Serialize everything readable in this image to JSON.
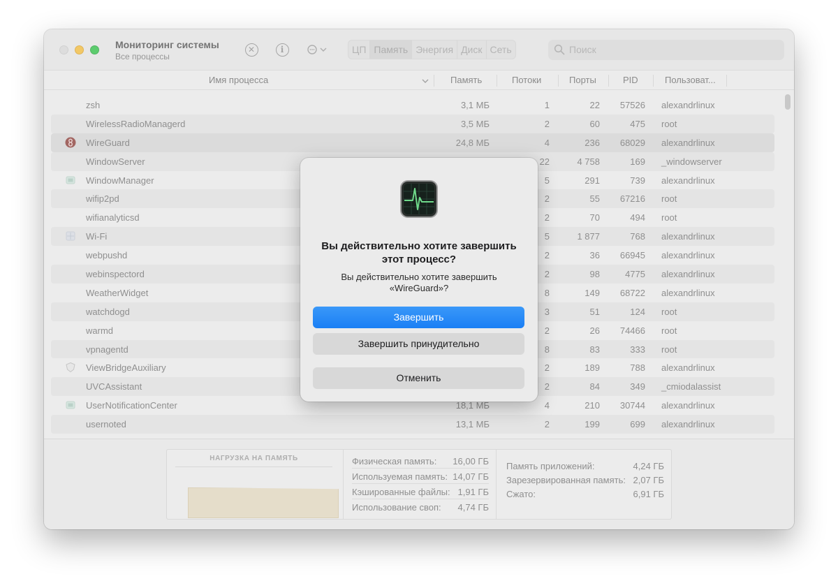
{
  "app": {
    "title": "Мониторинг системы",
    "subtitle": "Все процессы"
  },
  "toolbar": {
    "tabs": [
      "ЦП",
      "Память",
      "Энергия",
      "Диск",
      "Сеть"
    ],
    "active_tab": "Память",
    "search_placeholder": "Поиск"
  },
  "table": {
    "columns": {
      "name": "Имя процесса",
      "memory": "Память",
      "threads": "Потоки",
      "ports": "Порты",
      "pid": "PID",
      "user": "Пользоват..."
    },
    "rows": [
      {
        "name": "zsh",
        "memory": "3,1 МБ",
        "threads": "1",
        "ports": "22",
        "pid": "57526",
        "user": "alexandrlinux",
        "icon": "none"
      },
      {
        "name": "WirelessRadioManagerd",
        "memory": "3,5 МБ",
        "threads": "2",
        "ports": "60",
        "pid": "475",
        "user": "root",
        "icon": "none"
      },
      {
        "name": "WireGuard",
        "memory": "24,8 МБ",
        "threads": "4",
        "ports": "236",
        "pid": "68029",
        "user": "alexandrlinux",
        "icon": "wireguard-icon"
      },
      {
        "name": "WindowServer",
        "memory": "",
        "threads": "22",
        "ports": "4 758",
        "pid": "169",
        "user": "_windowserver",
        "icon": "none"
      },
      {
        "name": "WindowManager",
        "memory": "",
        "threads": "5",
        "ports": "291",
        "pid": "739",
        "user": "alexandrlinux",
        "icon": "window-icon"
      },
      {
        "name": "wifip2pd",
        "memory": "",
        "threads": "2",
        "ports": "55",
        "pid": "67216",
        "user": "root",
        "icon": "none"
      },
      {
        "name": "wifianalyticsd",
        "memory": "",
        "threads": "2",
        "ports": "70",
        "pid": "494",
        "user": "root",
        "icon": "none"
      },
      {
        "name": "Wi-Fi",
        "memory": "",
        "threads": "5",
        "ports": "1 877",
        "pid": "768",
        "user": "alexandrlinux",
        "icon": "grid-icon"
      },
      {
        "name": "webpushd",
        "memory": "",
        "threads": "2",
        "ports": "36",
        "pid": "66945",
        "user": "alexandrlinux",
        "icon": "none"
      },
      {
        "name": "webinspectord",
        "memory": "",
        "threads": "2",
        "ports": "98",
        "pid": "4775",
        "user": "alexandrlinux",
        "icon": "none"
      },
      {
        "name": "WeatherWidget",
        "memory": "",
        "threads": "8",
        "ports": "149",
        "pid": "68722",
        "user": "alexandrlinux",
        "icon": "none"
      },
      {
        "name": "watchdogd",
        "memory": "",
        "threads": "3",
        "ports": "51",
        "pid": "124",
        "user": "root",
        "icon": "none"
      },
      {
        "name": "warmd",
        "memory": "",
        "threads": "2",
        "ports": "26",
        "pid": "74466",
        "user": "root",
        "icon": "none"
      },
      {
        "name": "vpnagentd",
        "memory": "",
        "threads": "8",
        "ports": "83",
        "pid": "333",
        "user": "root",
        "icon": "none"
      },
      {
        "name": "ViewBridgeAuxiliary",
        "memory": "",
        "threads": "2",
        "ports": "189",
        "pid": "788",
        "user": "alexandrlinux",
        "icon": "shield-icon"
      },
      {
        "name": "UVCAssistant",
        "memory": "",
        "threads": "2",
        "ports": "84",
        "pid": "349",
        "user": "_cmiodalassist",
        "icon": "none"
      },
      {
        "name": "UserNotificationCenter",
        "memory": "18,1 МБ",
        "threads": "4",
        "ports": "210",
        "pid": "30744",
        "user": "alexandrlinux",
        "icon": "window-icon"
      },
      {
        "name": "usernoted",
        "memory": "13,1 МБ",
        "threads": "2",
        "ports": "199",
        "pid": "699",
        "user": "alexandrlinux",
        "icon": "none"
      }
    ]
  },
  "memory_panel": {
    "pressure_title": "НАГРУЗКА НА ПАМЯТЬ",
    "stats_left": [
      {
        "label": "Физическая память:",
        "value": "16,00 ГБ"
      },
      {
        "label": "Используемая память:",
        "value": "14,07 ГБ"
      },
      {
        "label": "Кэшированные файлы:",
        "value": "1,91 ГБ"
      },
      {
        "label": "Использование своп:",
        "value": "4,74 ГБ"
      }
    ],
    "stats_right": [
      {
        "label": "Память приложений:",
        "value": "4,24 ГБ"
      },
      {
        "label": "Зарезервированная память:",
        "value": "2,07 ГБ"
      },
      {
        "label": "Сжато:",
        "value": "6,91 ГБ"
      }
    ]
  },
  "dialog": {
    "title": "Вы действительно хотите завершить этот процесс?",
    "message": "Вы действительно хотите завершить «WireGuard»?",
    "quit_label": "Завершить",
    "force_quit_label": "Завершить принудительно",
    "cancel_label": "Отменить"
  },
  "colors": {
    "accent": "#1a7ff5",
    "close_button": "#d9d9d9",
    "minimize_button": "#f5bd3a",
    "zoom_button": "#2dc245"
  }
}
